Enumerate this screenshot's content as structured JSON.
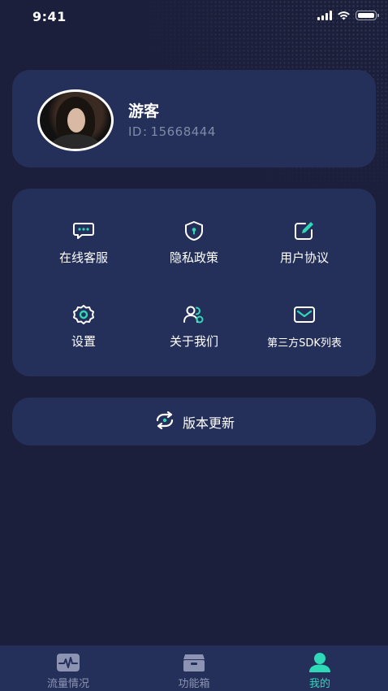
{
  "status_bar": {
    "time": "9:41"
  },
  "profile": {
    "name": "游客",
    "id_label": "ID",
    "id_separator": ":",
    "id_value": "15668444"
  },
  "menu": {
    "items": [
      {
        "label": "在线客服",
        "icon": "chat-bubble-icon"
      },
      {
        "label": "隐私政策",
        "icon": "shield-lock-icon"
      },
      {
        "label": "用户协议",
        "icon": "edit-document-icon"
      },
      {
        "label": "设置",
        "icon": "gear-icon"
      },
      {
        "label": "关于我们",
        "icon": "users-icon"
      },
      {
        "label": "第三方SDK列表",
        "icon": "mail-icon"
      }
    ]
  },
  "update": {
    "label": "版本更新",
    "icon": "refresh-icon"
  },
  "tabbar": {
    "tabs": [
      {
        "label": "流量情况",
        "icon": "pulse-icon",
        "active": false
      },
      {
        "label": "功能箱",
        "icon": "toolbox-icon",
        "active": false
      },
      {
        "label": "我的",
        "icon": "user-icon",
        "active": true
      }
    ]
  },
  "colors": {
    "background": "#1b1f3b",
    "card": "#25305a",
    "accent": "#2ed9b8",
    "muted": "#7f89a8"
  }
}
